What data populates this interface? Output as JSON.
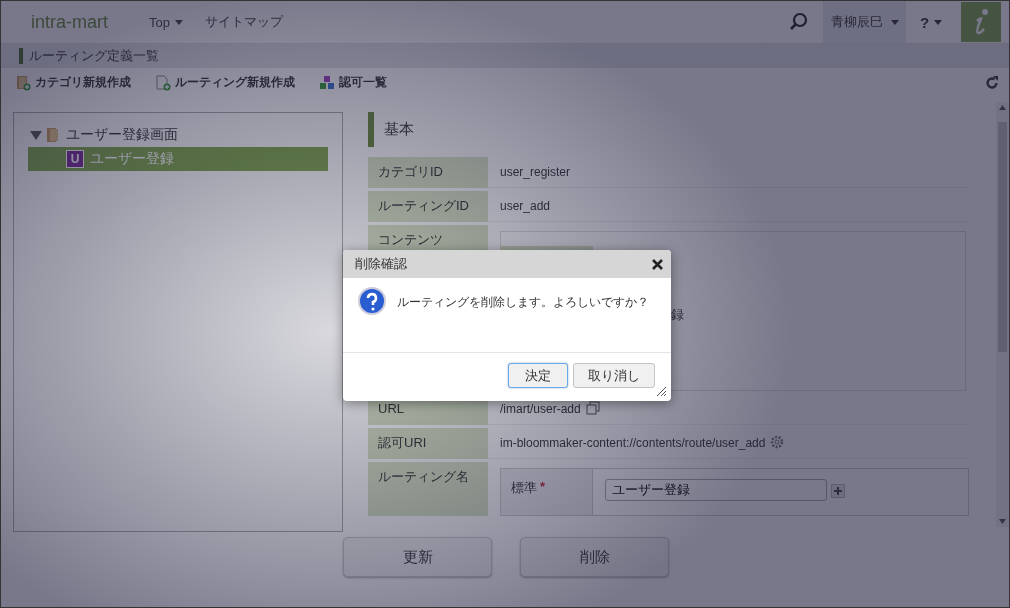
{
  "header": {
    "logo": "intra-mart",
    "nav": [
      {
        "label": "Top",
        "dropdown": true
      },
      {
        "label": "サイトマップ",
        "dropdown": false
      }
    ],
    "user": "青柳辰巳",
    "help": "?"
  },
  "page_title": "ルーティング定義一覧",
  "toolbar": [
    {
      "label": "カテゴリ新規作成",
      "kind": "category"
    },
    {
      "label": "ルーティング新規作成",
      "kind": "routing"
    },
    {
      "label": "認可一覧",
      "kind": "authz"
    }
  ],
  "tree": [
    {
      "label": "ユーザー登録画面",
      "expanded": true,
      "selected": false,
      "children": [
        {
          "label": "ユーザー登録",
          "badge": "U",
          "selected": true
        }
      ]
    }
  ],
  "section_title": "基本",
  "fields": [
    {
      "label": "カテゴリID",
      "kind": "text",
      "value": "user_register"
    },
    {
      "label": "ルーティングID",
      "kind": "text",
      "value": "user_add"
    },
    {
      "label": "コンテンツ",
      "kind": "contents",
      "fragment": "録"
    },
    {
      "label": "URL",
      "kind": "copy",
      "value": "/imart/user-add"
    },
    {
      "label": "認可URI",
      "kind": "gear",
      "value": "im-bloommaker-content://contents/route/user_add"
    },
    {
      "label": "ルーティング名",
      "kind": "names",
      "locale": "標準",
      "required": true,
      "required_mark": "*",
      "value": "ユーザー登録"
    }
  ],
  "buttons": [
    "更新",
    "削除"
  ],
  "dialog": {
    "title": "削除確認",
    "message": "ルーティングを削除します。よろしいですか？",
    "buttons": [
      {
        "label": "決定",
        "focused": true
      },
      {
        "label": "取り消し",
        "focused": false
      }
    ]
  }
}
